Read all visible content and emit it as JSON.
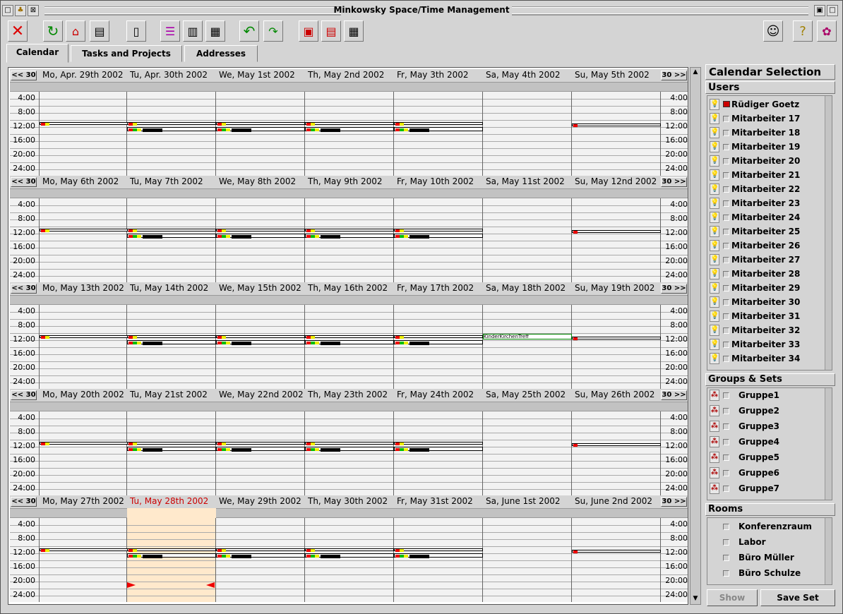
{
  "window": {
    "title": "Minkowsky Space/Time Management"
  },
  "tabs": [
    {
      "label": "Calendar"
    },
    {
      "label": "Tasks and Projects"
    },
    {
      "label": "Addresses"
    }
  ],
  "nav": {
    "prev": "<< 30",
    "next": "30 >>"
  },
  "times": [
    "4:00",
    "8:00",
    "12:00",
    "16:00",
    "20:00",
    "24:00"
  ],
  "weeks": [
    {
      "days": [
        "Mo,   Apr. 29th 2002",
        "Tu,   Apr. 30th 2002",
        "We,   May   1st 2002",
        "Th,   May   2nd 2002",
        "Fr,   May   3th 2002",
        "Sa,   May   4th 2002",
        "Su,   May   5th 2002"
      ]
    },
    {
      "days": [
        "Mo,   May   6th 2002",
        "Tu,   May   7th 2002",
        "We,   May   8th 2002",
        "Th,   May   9th 2002",
        "Fr,   May 10th 2002",
        "Sa,   May 11st 2002",
        "Su,   May 12nd 2002"
      ]
    },
    {
      "days": [
        "Mo,   May 13th 2002",
        "Tu,   May 14th 2002",
        "We,   May 15th 2002",
        "Th,   May 16th 2002",
        "Fr,   May 17th 2002",
        "Sa,   May 18th 2002",
        "Su,   May 19th 2002"
      ],
      "event_text": "KinderKirchenTreff"
    },
    {
      "days": [
        "Mo,   May 20th 2002",
        "Tu,   May 21st 2002",
        "We,   May 22nd 2002",
        "Th,   May 23th 2002",
        "Fr,   May 24th 2002",
        "Sa,   May 25th 2002",
        "Su,   May 26th 2002"
      ]
    },
    {
      "days": [
        "Mo,   May 27th 2002",
        "Tu,   May 28th 2002",
        "We,   May 29th 2002",
        "Th,   May 30th 2002",
        "Fr,   May 31st 2002",
        "Sa,   June   1st 2002",
        "Su,   June   2nd 2002"
      ]
    }
  ],
  "today_color": "#ffe9cc",
  "sidebar": {
    "title": "Calendar Selection",
    "users_label": "Users",
    "users": [
      "Rüdiger Goetz",
      "Mitarbeiter 17",
      "Mitarbeiter 18",
      "Mitarbeiter 19",
      "Mitarbeiter 20",
      "Mitarbeiter 21",
      "Mitarbeiter 22",
      "Mitarbeiter 23",
      "Mitarbeiter 24",
      "Mitarbeiter 25",
      "Mitarbeiter 26",
      "Mitarbeiter 27",
      "Mitarbeiter 28",
      "Mitarbeiter 29",
      "Mitarbeiter 30",
      "Mitarbeiter 31",
      "Mitarbeiter 32",
      "Mitarbeiter 33",
      "Mitarbeiter 34"
    ],
    "groups_label": "Groups & Sets",
    "groups": [
      "Gruppe1",
      "Gruppe2",
      "Gruppe3",
      "Gruppe4",
      "Gruppe5",
      "Gruppe6",
      "Gruppe7"
    ],
    "rooms_label": "Rooms",
    "rooms": [
      "Konferenzraum",
      "Labor",
      "Büro Müller",
      "Büro Schulze"
    ],
    "show_button": "Show",
    "save_button": "Save Set"
  }
}
